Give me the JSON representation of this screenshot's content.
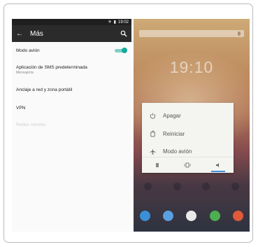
{
  "settings": {
    "status_time": "19:02",
    "title": "Más",
    "items": [
      {
        "label": "Modo avión",
        "toggle_on": true
      },
      {
        "label": "Aplicación de SMS predeterminada",
        "sub": "Mensajería"
      },
      {
        "label": "Anclaje a red y zona portátil"
      },
      {
        "label": "VPN"
      },
      {
        "label": "Redes móviles",
        "disabled": true
      }
    ],
    "accent_color": "#17a99a"
  },
  "power_menu": {
    "clock": "19:10",
    "options": [
      {
        "label": "Apagar",
        "icon": "power-icon"
      },
      {
        "label": "Reiniciar",
        "icon": "restart-icon"
      },
      {
        "label": "Modo avión",
        "icon": "airplane-icon"
      }
    ],
    "bottom_icons": [
      "silent-icon",
      "vibrate-icon",
      "sound-icon"
    ]
  }
}
